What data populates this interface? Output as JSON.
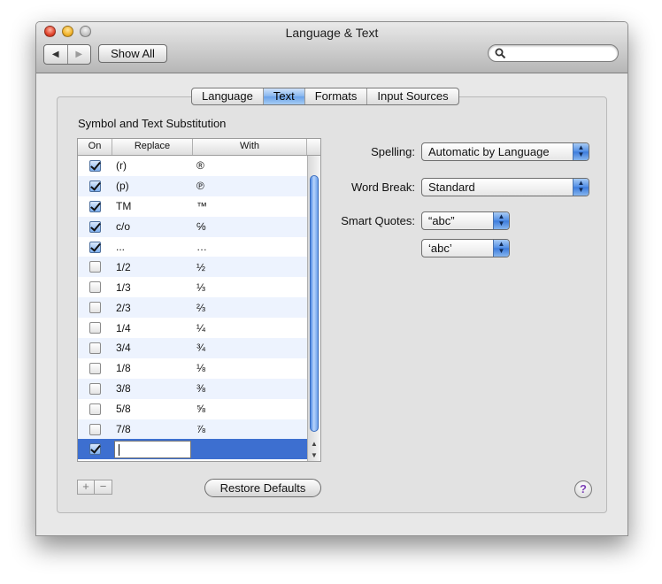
{
  "window": {
    "title": "Language & Text"
  },
  "toolbar": {
    "back": "◀",
    "forward": "▶",
    "show_all": "Show All",
    "search_placeholder": ""
  },
  "tabs": [
    "Language",
    "Text",
    "Formats",
    "Input Sources"
  ],
  "active_tab": "Text",
  "section_title": "Symbol and Text Substitution",
  "table": {
    "headers": {
      "on": "On",
      "replace": "Replace",
      "with": "With"
    },
    "rows": [
      {
        "on": true,
        "replace": "(r)",
        "with": "®"
      },
      {
        "on": true,
        "replace": "(p)",
        "with": "℗"
      },
      {
        "on": true,
        "replace": "TM",
        "with": "™"
      },
      {
        "on": true,
        "replace": "c/o",
        "with": "℅"
      },
      {
        "on": true,
        "replace": "...",
        "with": "…"
      },
      {
        "on": false,
        "replace": "1/2",
        "with": "½"
      },
      {
        "on": false,
        "replace": "1/3",
        "with": "⅓"
      },
      {
        "on": false,
        "replace": "2/3",
        "with": "⅔"
      },
      {
        "on": false,
        "replace": "1/4",
        "with": "¼"
      },
      {
        "on": false,
        "replace": "3/4",
        "with": "¾"
      },
      {
        "on": false,
        "replace": "1/8",
        "with": "⅛"
      },
      {
        "on": false,
        "replace": "3/8",
        "with": "⅜"
      },
      {
        "on": false,
        "replace": "5/8",
        "with": "⅝"
      },
      {
        "on": false,
        "replace": "7/8",
        "with": "⅞"
      },
      {
        "on": true,
        "replace": "",
        "with": "",
        "editing": true
      }
    ]
  },
  "buttons": {
    "add": "+",
    "remove": "−",
    "restore_defaults": "Restore Defaults",
    "help": "?"
  },
  "settings": {
    "spelling_label": "Spelling:",
    "spelling_value": "Automatic by Language",
    "word_break_label": "Word Break:",
    "word_break_value": "Standard",
    "smart_quotes_label": "Smart Quotes:",
    "double_quotes_value": "“abc”",
    "single_quotes_value": "‘abc’"
  },
  "colors": {
    "selection": "#3d6fd0",
    "stripe": "#edf3fe",
    "accent": "#4f8ce4"
  }
}
